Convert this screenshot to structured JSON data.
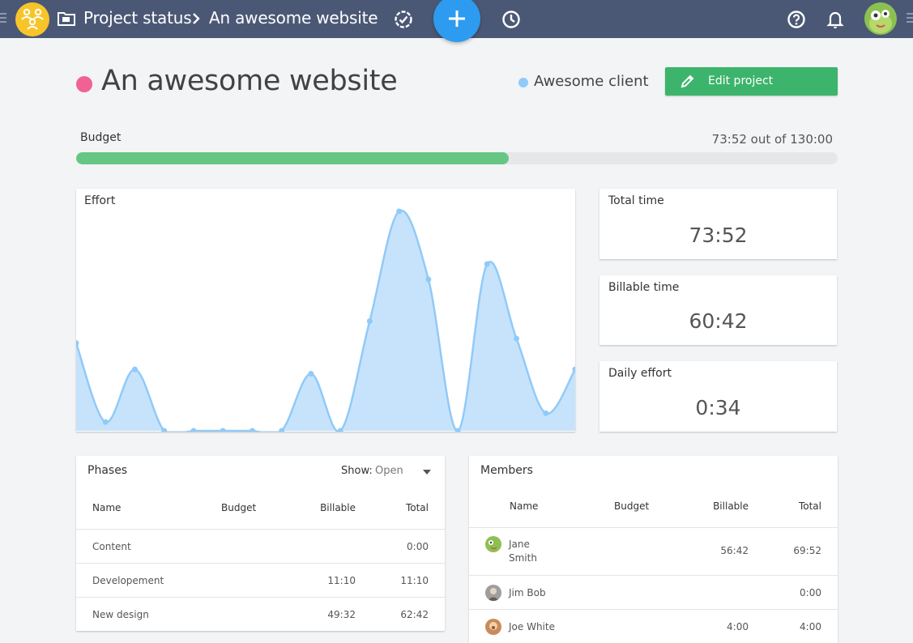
{
  "topbar": {
    "breadcrumb_root": "Project status",
    "breadcrumb_current": "An awesome website"
  },
  "project": {
    "title": "An awesome website",
    "client": "Awesome client",
    "edit_label": "Edit project",
    "color": "#f06292",
    "client_color": "#90caf9"
  },
  "budget": {
    "label": "Budget",
    "value_text": "73:52 out of 130:00",
    "progress": 0.568
  },
  "effort": {
    "title": "Effort",
    "chart_data": {
      "type": "area",
      "values": [
        40,
        4,
        28,
        0,
        0,
        0,
        0,
        0,
        26,
        0,
        50,
        100,
        69,
        0,
        76,
        42,
        8,
        28
      ],
      "ylim": [
        0,
        100
      ],
      "color": "#90caf9"
    }
  },
  "stats": [
    {
      "title": "Total time",
      "value": "73:52"
    },
    {
      "title": "Billable time",
      "value": "60:42"
    },
    {
      "title": "Daily effort",
      "value": "0:34"
    }
  ],
  "phases": {
    "title": "Phases",
    "show_label": "Show:",
    "show_value": "Open",
    "columns": {
      "name": "Name",
      "budget": "Budget",
      "billable": "Billable",
      "total": "Total"
    },
    "rows": [
      {
        "name": "Content",
        "budget": "",
        "billable": "",
        "total": "0:00"
      },
      {
        "name": "Developement",
        "budget": "",
        "billable": "11:10",
        "total": "11:10"
      },
      {
        "name": "New design",
        "budget": "",
        "billable": "49:32",
        "total": "62:42"
      }
    ]
  },
  "members": {
    "title": "Members",
    "columns": {
      "name": "Name",
      "budget": "Budget",
      "billable": "Billable",
      "total": "Total"
    },
    "rows": [
      {
        "first": "Jane",
        "last": "Smith",
        "budget": "",
        "billable": "56:42",
        "total": "69:52"
      },
      {
        "name": "Jim Bob",
        "budget": "",
        "billable": "",
        "total": "0:00"
      },
      {
        "name": "Joe White",
        "budget": "",
        "billable": "4:00",
        "total": "4:00"
      }
    ]
  }
}
